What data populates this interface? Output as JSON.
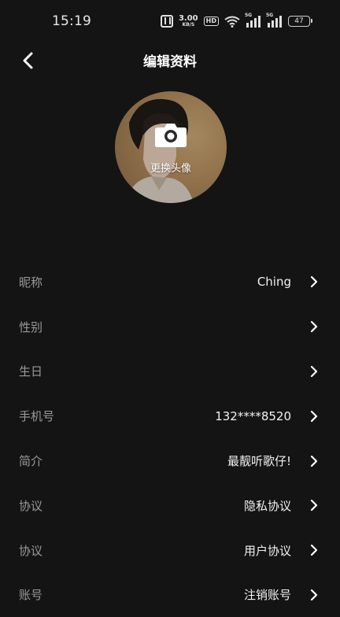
{
  "status_bar": {
    "time": "15:19",
    "net_speed_value": "3.00",
    "net_speed_unit": "KB/S",
    "hd_label": "HD",
    "sim1_tag": "5G",
    "sim2_tag": "5G",
    "battery_level": "47"
  },
  "header": {
    "title": "编辑资料",
    "back_icon": "chevron-left-icon"
  },
  "avatar": {
    "label": "更换头像",
    "icon": "camera-icon"
  },
  "rows": [
    {
      "label": "昵称",
      "value": "Ching"
    },
    {
      "label": "性别",
      "value": ""
    },
    {
      "label": "生日",
      "value": ""
    },
    {
      "label": "手机号",
      "value": "132****8520"
    },
    {
      "label": "简介",
      "value": "最靓听歌仔!"
    },
    {
      "label": "协议",
      "value": "隐私协议"
    },
    {
      "label": "协议",
      "value": "用户协议"
    },
    {
      "label": "账号",
      "value": "注销账号"
    }
  ],
  "colors": {
    "background": "#141414",
    "label": "#9a9a9a",
    "value": "#f2f2f2"
  }
}
